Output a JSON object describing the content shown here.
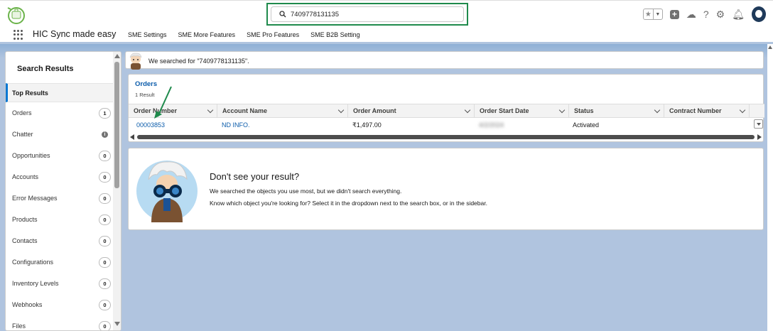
{
  "header": {
    "search_value": "7409778131135"
  },
  "nav": {
    "app_name": "HIC Sync made easy",
    "tabs": [
      "SME Settings",
      "SME More Features",
      "SME Pro Features",
      "SME B2B Setting"
    ]
  },
  "sidebar": {
    "title": "Search Results",
    "top_results_label": "Top Results",
    "items": [
      {
        "label": "Orders",
        "count": "1"
      },
      {
        "label": "Chatter",
        "count": ""
      },
      {
        "label": "Opportunities",
        "count": "0"
      },
      {
        "label": "Accounts",
        "count": "0"
      },
      {
        "label": "Error Messages",
        "count": "0"
      },
      {
        "label": "Products",
        "count": "0"
      },
      {
        "label": "Contacts",
        "count": "0"
      },
      {
        "label": "Configurations",
        "count": "0"
      },
      {
        "label": "Inventory Levels",
        "count": "0"
      },
      {
        "label": "Webhooks",
        "count": "0"
      },
      {
        "label": "Files",
        "count": "0"
      }
    ]
  },
  "main": {
    "searched_text": "We searched for \"7409778131135\".",
    "orders": {
      "title": "Orders",
      "count_text": "1 Result",
      "columns": [
        "Order Number",
        "Account Name",
        "Order Amount",
        "Order Start Date",
        "Status",
        "Contract Number"
      ],
      "rows": [
        {
          "order_number": "00003853",
          "account_name": "ND INFO.",
          "order_amount": "₹1,497.00",
          "order_start_date": "4/2/2024",
          "status": "Activated",
          "contract_number": ""
        }
      ]
    },
    "no_result": {
      "title": "Don't see your result?",
      "line1": "We searched the objects you use most, but we didn't search everything.",
      "line2": "Know which object you're looking for? Select it in the dropdown next to the search box, or in the sidebar."
    }
  },
  "colors": {
    "accent": "#0176d3",
    "link": "#0b5cab",
    "highlight_box": "#1f8a4c",
    "background": "#b0c4df"
  }
}
